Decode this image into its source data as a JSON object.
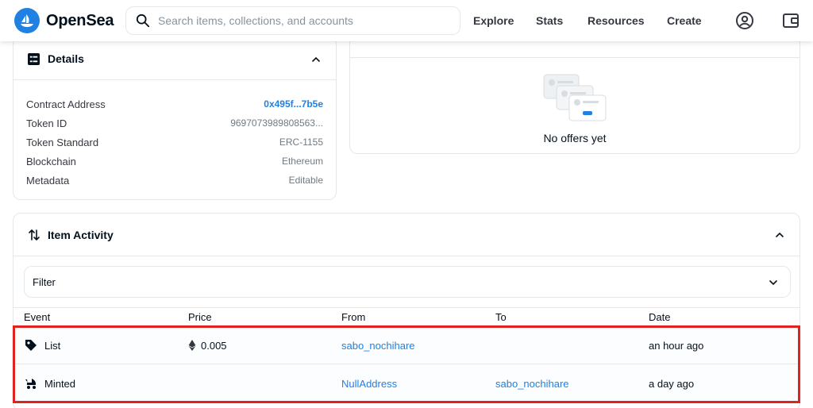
{
  "header": {
    "logo_text": "OpenSea",
    "search_placeholder": "Search items, collections, and accounts",
    "nav": [
      "Explore",
      "Stats",
      "Resources",
      "Create"
    ]
  },
  "details": {
    "title": "Details",
    "rows": [
      {
        "label": "Contract Address",
        "value": "0x495f...7b5e"
      },
      {
        "label": "Token ID",
        "value": "9697073989808563..."
      },
      {
        "label": "Token Standard",
        "value": "ERC-1155"
      },
      {
        "label": "Blockchain",
        "value": "Ethereum"
      },
      {
        "label": "Metadata",
        "value": "Editable"
      }
    ]
  },
  "offers": {
    "empty_text": "No offers yet"
  },
  "activity": {
    "title": "Item Activity",
    "filter_label": "Filter",
    "columns": [
      "Event",
      "Price",
      "From",
      "To",
      "Date"
    ],
    "rows": [
      {
        "event": "List",
        "price": "0.005",
        "from": "sabo_nochihare",
        "to": "",
        "date": "an hour ago"
      },
      {
        "event": "Minted",
        "price": "",
        "from": "NullAddress",
        "to": "sabo_nochihare",
        "date": "a day ago"
      }
    ]
  },
  "colors": {
    "accent": "#2081e2",
    "highlight": "#e0231e"
  }
}
